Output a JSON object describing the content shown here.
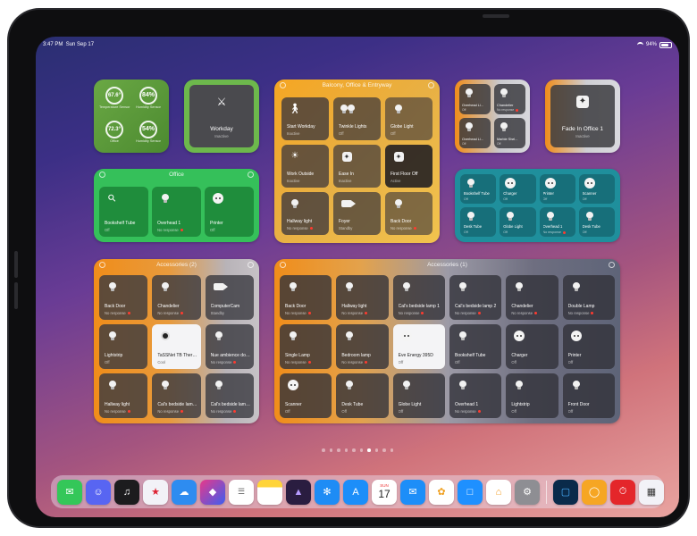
{
  "status": {
    "time": "3:47 PM",
    "date": "Sun Sep 17",
    "battery": "94%"
  },
  "sensors": [
    {
      "value": "67.6°",
      "label": "Temperature Sensor"
    },
    {
      "value": "84%",
      "label": "Humidity Sensor"
    },
    {
      "value": "72.3°",
      "label": "Office"
    },
    {
      "value": "54%",
      "label": "Humidity Sensor"
    }
  ],
  "workday": {
    "name": "Workday",
    "status": "Inactive"
  },
  "balcony": {
    "title": "Balcony, Office & Entryway",
    "tiles": [
      {
        "name": "Start Workday",
        "status": "Inactive",
        "icon": "person-walking-icon"
      },
      {
        "name": "Twinkle Lights",
        "status": "Off",
        "icon": "lightbulbs-icon"
      },
      {
        "name": "Globe Light",
        "status": "Off",
        "icon": "lightbulb-icon"
      },
      {
        "name": "Work Outside",
        "status": "Inactive",
        "icon": "lamp-icon"
      },
      {
        "name": "Ease In",
        "status": "Inactive",
        "icon": "scene-icon"
      },
      {
        "name": "First Floor Off",
        "status": "Active",
        "icon": "scene-icon"
      },
      {
        "name": "Hallway light",
        "status": "No response",
        "icon": "bulb-icon"
      },
      {
        "name": "Foyer",
        "status": "Standby",
        "icon": "camera-icon"
      },
      {
        "name": "Back Door",
        "status": "No response",
        "icon": "bulb-icon"
      }
    ]
  },
  "small_four": {
    "tiles": [
      {
        "name": "Overhead Li...",
        "status": "Off"
      },
      {
        "name": "Chandelier",
        "status": "No response"
      },
      {
        "name": "Overhead Li...",
        "status": "Off"
      },
      {
        "name": "Marble Shel...",
        "status": "Off"
      }
    ]
  },
  "fade": {
    "name": "Fade In Office 1",
    "status": "Inactive"
  },
  "office": {
    "title": "Office",
    "tiles": [
      {
        "name": "Bookshelf Tube",
        "status": "Off"
      },
      {
        "name": "Overhead 1",
        "status": "No response"
      },
      {
        "name": "Printer",
        "status": "Off"
      }
    ]
  },
  "teal": {
    "tiles": [
      {
        "name": "Bookshelf Tube",
        "status": "Off"
      },
      {
        "name": "Charger",
        "status": "Off"
      },
      {
        "name": "Printer",
        "status": "Off"
      },
      {
        "name": "Scanner",
        "status": "Off"
      },
      {
        "name": "Desk Tube",
        "status": "Off"
      },
      {
        "name": "Globe Light",
        "status": "Off"
      },
      {
        "name": "Overhead 1",
        "status": "No response"
      },
      {
        "name": "Desk Tube",
        "status": "Off"
      }
    ]
  },
  "accessories_small": {
    "title": "Accessories (2)",
    "tiles": [
      {
        "name": "Back Door",
        "status": "No response"
      },
      {
        "name": "Chandelier",
        "status": "No response"
      },
      {
        "name": "ComputerCam",
        "status": "Standby"
      },
      {
        "name": "Lightstrip",
        "status": "Off"
      },
      {
        "name": "TaSSNet TB Thermo...",
        "status": "Cool"
      },
      {
        "name": "Nue ambience down...",
        "status": "No response"
      },
      {
        "name": "Hallway light",
        "status": "No response"
      },
      {
        "name": "Cal's bedside lamp 2",
        "status": "No response"
      },
      {
        "name": "Cal's bedside lamp 1",
        "status": "No response"
      }
    ]
  },
  "accessories_large": {
    "title": "Accessories (1)",
    "tiles": [
      {
        "name": "Back Door",
        "status": "No response"
      },
      {
        "name": "Hallway light",
        "status": "No response"
      },
      {
        "name": "Cal's bedside lamp 1",
        "status": "No response"
      },
      {
        "name": "Cal's bedside lamp 2",
        "status": "No response"
      },
      {
        "name": "Chandelier",
        "status": "No response"
      },
      {
        "name": "Double Lamp",
        "status": "No response"
      },
      {
        "name": "Single Lamp",
        "status": "No response"
      },
      {
        "name": "Bedroom lamp",
        "status": "No response"
      },
      {
        "name": "Eve Energy 395D",
        "status": "Off"
      },
      {
        "name": "Bookshelf Tube",
        "status": "Off"
      },
      {
        "name": "Charger",
        "status": "Off"
      },
      {
        "name": "Printer",
        "status": "Off"
      },
      {
        "name": "Scanner",
        "status": "Off"
      },
      {
        "name": "Desk Tube",
        "status": "Off"
      },
      {
        "name": "Globe Light",
        "status": "Off"
      },
      {
        "name": "Overhead 1",
        "status": "No response"
      },
      {
        "name": "Lightstrip",
        "status": "Off"
      },
      {
        "name": "Front Door",
        "status": "Off"
      }
    ]
  },
  "calendar": {
    "month": "SUN",
    "day": "17"
  },
  "dock": {
    "apps": [
      "messages-icon",
      "discord-icon",
      "music-icon",
      "app-icon",
      "icloud-icon",
      "shortcuts-icon",
      "reminders-icon",
      "notes-icon",
      "app-icon",
      "safari-icon",
      "app-store-icon",
      "calendar-icon",
      "mail-icon",
      "photos-icon",
      "files-icon",
      "home-icon",
      "settings-icon"
    ],
    "recent": [
      "app-icon",
      "app-icon",
      "timer-icon",
      "app-icon"
    ]
  },
  "colors": {
    "green": "#5b9a3a",
    "bright_green": "#35c05a",
    "orange": "#f49a1c",
    "teal": "#1f8f9c",
    "gray": "#8e8e93"
  }
}
